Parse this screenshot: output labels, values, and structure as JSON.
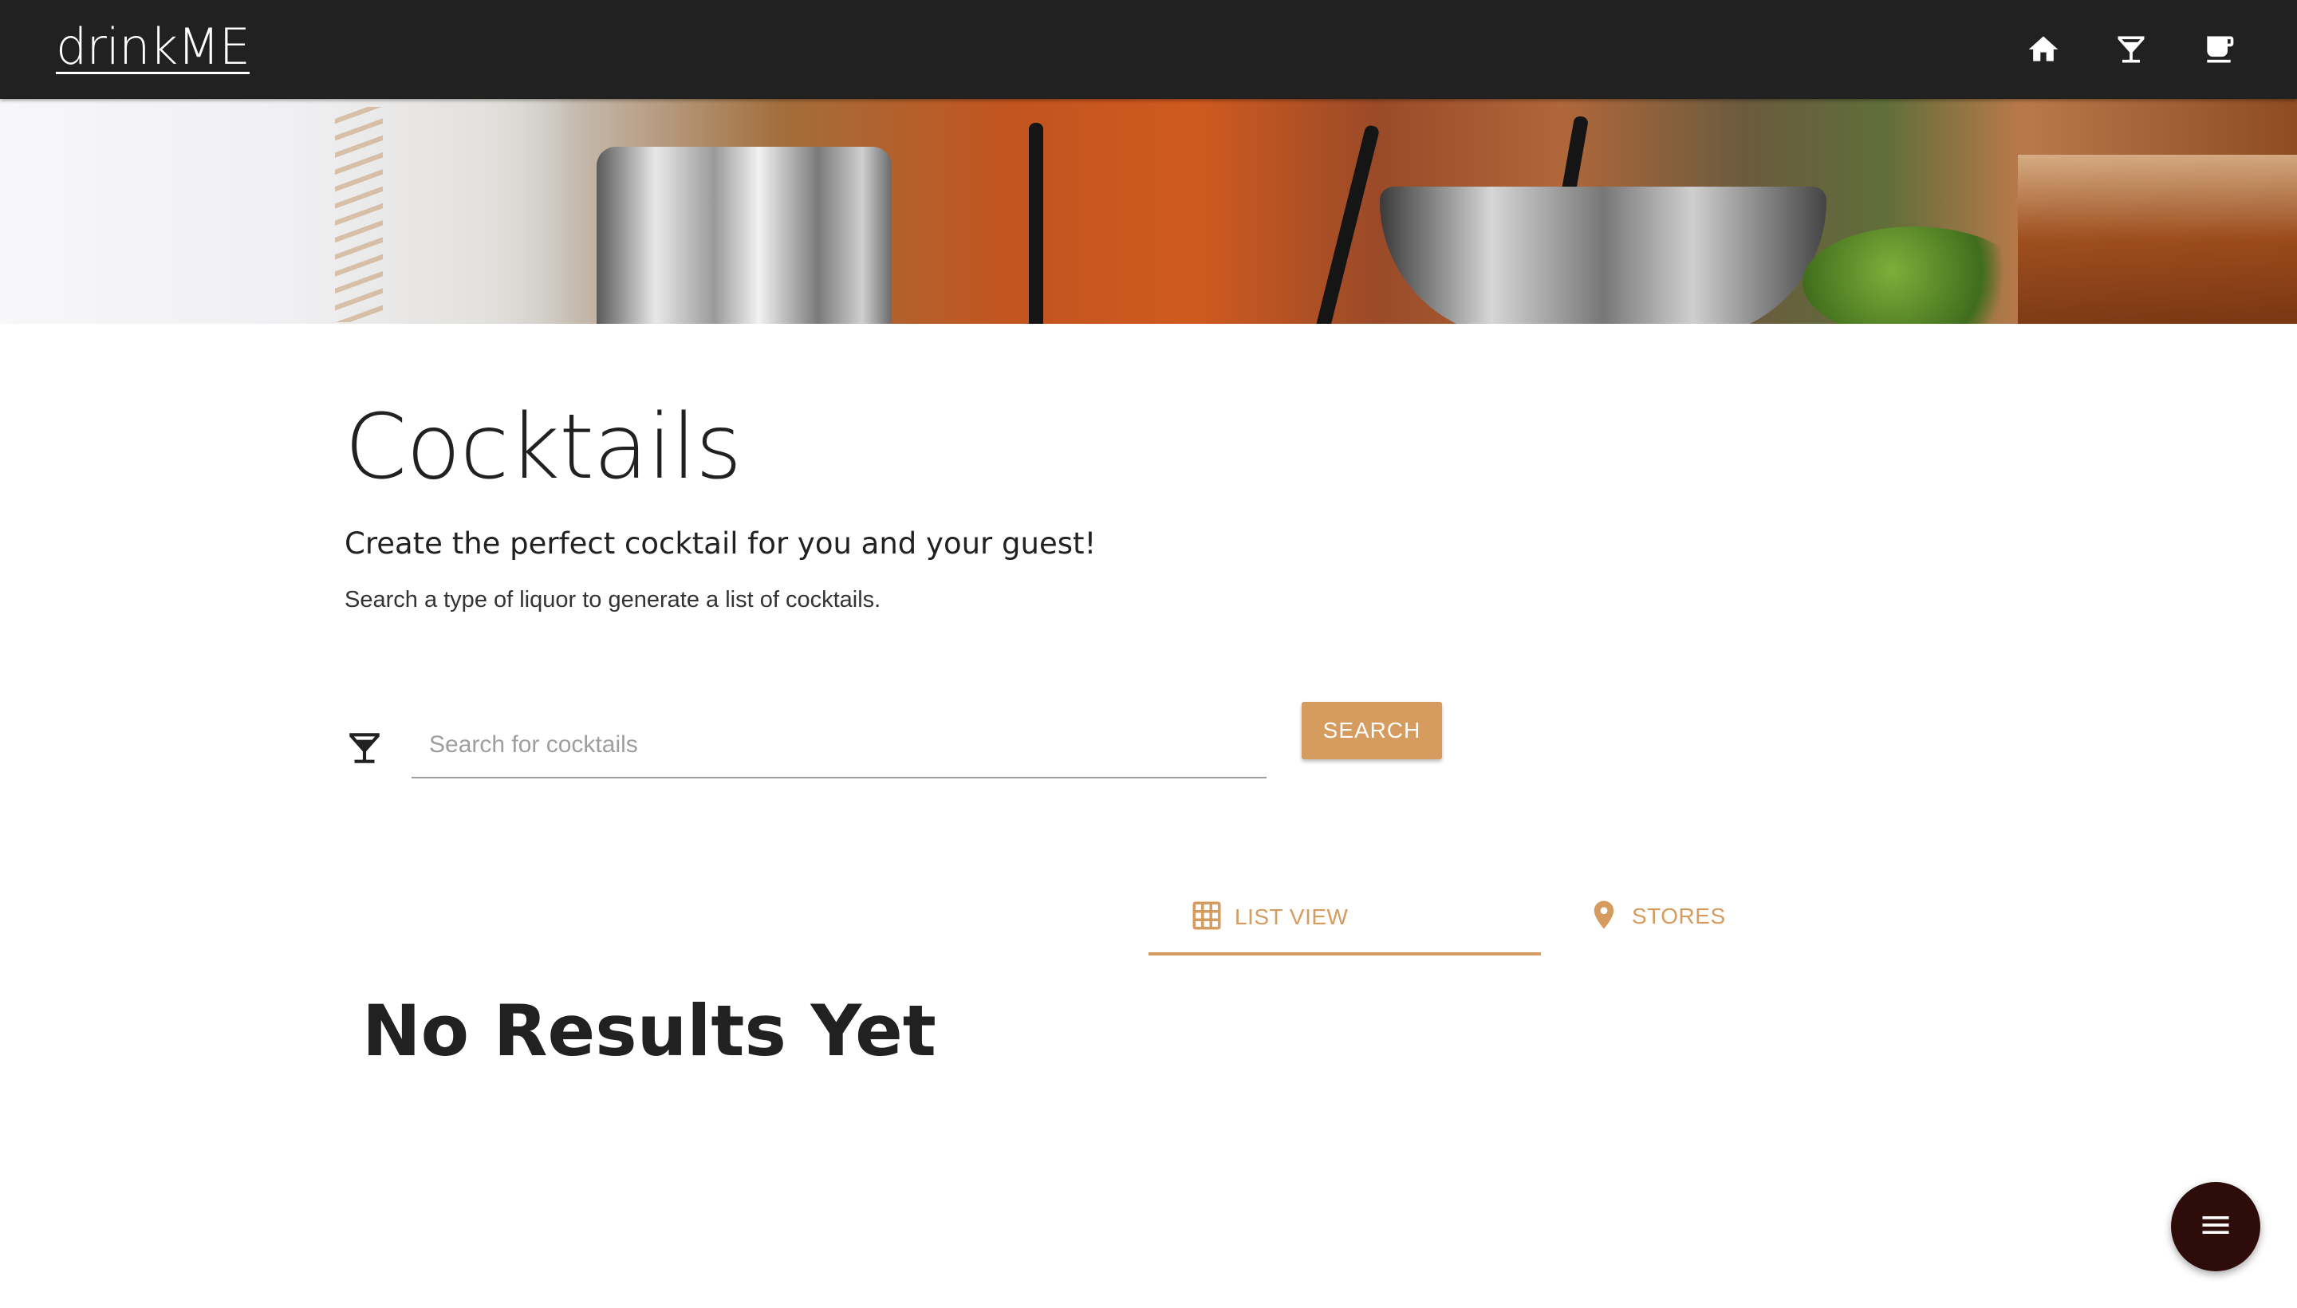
{
  "navbar": {
    "brand": "drinkME",
    "icons": [
      "home-icon",
      "cocktail-icon",
      "coffee-icon"
    ]
  },
  "hero": {
    "image": "bar-tools-hero-image"
  },
  "main": {
    "title": "Cocktails",
    "subtitle": "Create the perfect cocktail for you and your guest!",
    "helper_text": "Search a type of liquor to generate a list of cocktails."
  },
  "search": {
    "icon": "cocktail-icon",
    "placeholder": "Search for cocktails",
    "value": "",
    "button_label": "SEARCH"
  },
  "tabs": [
    {
      "label": "LIST VIEW",
      "icon": "grid-icon",
      "active": true
    },
    {
      "label": "STORES",
      "icon": "location-pin-icon",
      "active": false
    }
  ],
  "results": {
    "empty_message": "No Results Yet"
  },
  "fab": {
    "icon": "menu-icon"
  },
  "colors": {
    "navbar": "#212121",
    "accent": "#d59b5f",
    "fab": "#2e0c09",
    "text": "#212121"
  }
}
